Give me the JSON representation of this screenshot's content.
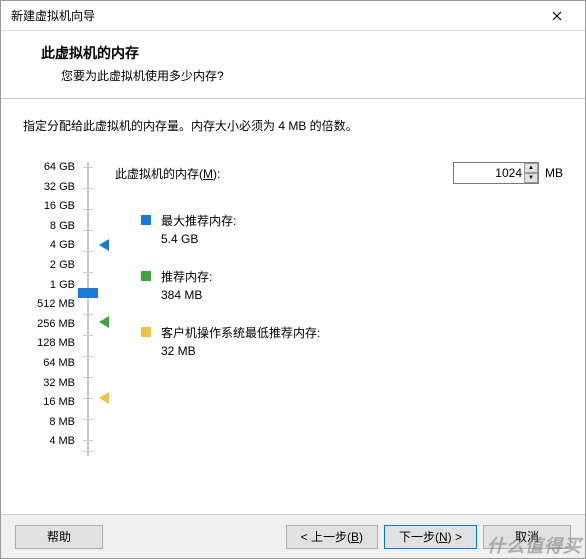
{
  "window": {
    "title": "新建虚拟机向导"
  },
  "header": {
    "title": "此虚拟机的内存",
    "subtitle": "您要为此虚拟机使用多少内存?"
  },
  "instruction": "指定分配给此虚拟机的内存量。内存大小必须为 4 MB 的倍数。",
  "memory": {
    "label_prefix": "此虚拟机的内存(",
    "label_key": "M",
    "label_suffix": "):",
    "value": "1024",
    "unit": "MB"
  },
  "ticks": [
    "64 GB",
    "32 GB",
    "16 GB",
    "8 GB",
    "4 GB",
    "2 GB",
    "1 GB",
    "512 MB",
    "256 MB",
    "128 MB",
    "64 MB",
    "32 MB",
    "16 MB",
    "8 MB",
    "4 MB"
  ],
  "recommendations": {
    "max": {
      "label": "最大推荐内存:",
      "value": "5.4 GB"
    },
    "rec": {
      "label": "推荐内存:",
      "value": "384 MB"
    },
    "min": {
      "label": "客户机操作系统最低推荐内存:",
      "value": "32 MB"
    }
  },
  "buttons": {
    "help": "帮助",
    "back_prefix": "< 上一步(",
    "back_key": "B",
    "back_suffix": ")",
    "next_prefix": "下一步(",
    "next_key": "N",
    "next_suffix": ") >",
    "cancel": "取消"
  },
  "watermark": "什么值得买"
}
